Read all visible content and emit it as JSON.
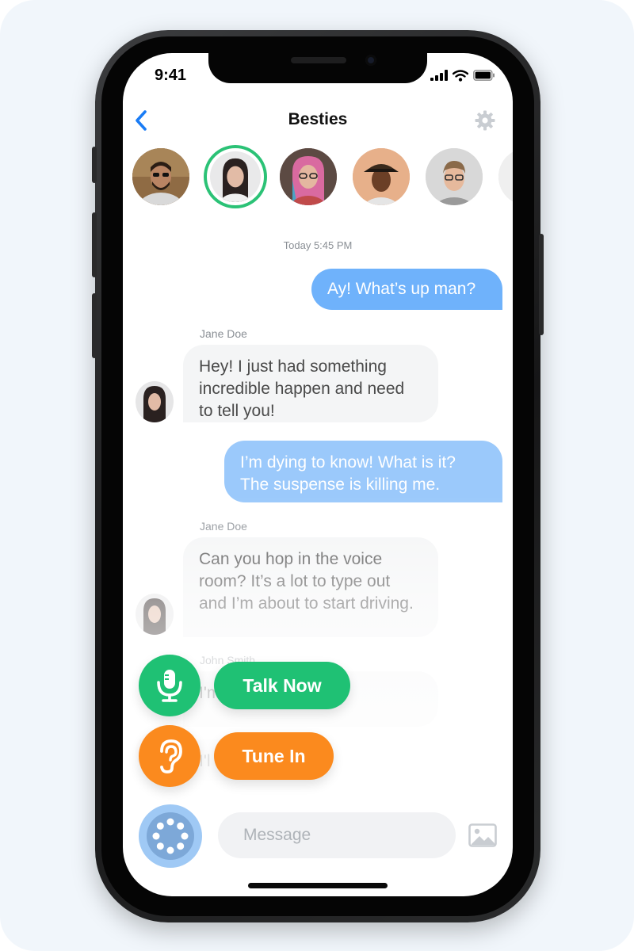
{
  "status_bar": {
    "time": "9:41"
  },
  "header": {
    "title": "Besties",
    "back_icon": "chevron-left-icon",
    "settings_icon": "gear-icon"
  },
  "avatars": [
    {
      "name": "member-1",
      "active": false
    },
    {
      "name": "member-2",
      "active": true
    },
    {
      "name": "member-3",
      "active": false
    },
    {
      "name": "member-4",
      "active": false
    },
    {
      "name": "member-5",
      "active": false
    },
    {
      "name": "member-6",
      "active": false
    }
  ],
  "chat": {
    "timestamp": "Today 5:45 PM",
    "messages": [
      {
        "direction": "out",
        "text": "Ay! What’s up man?"
      },
      {
        "direction": "in",
        "sender": "Jane Doe",
        "text": "Hey! I just had something incredible happen and need to tell you!"
      },
      {
        "direction": "out",
        "text": "I’m dying to know! What is it? The suspense is killing me."
      },
      {
        "direction": "in",
        "sender": "Jane Doe",
        "text": "Can you hop in the voice room? It’s a lot to type out and I’m about to start driving."
      },
      {
        "direction": "in",
        "sender": "John Smith",
        "text": "I'm ... want to hear!"
      },
      {
        "direction": "in",
        "sender": "",
        "text": "I'l"
      }
    ]
  },
  "actions": {
    "talk_now": {
      "label": "Talk Now",
      "icon": "microphone-icon",
      "color": "#1fc174"
    },
    "tune_in": {
      "label": "Tune In",
      "icon": "ear-icon",
      "color": "#fb8a1e"
    }
  },
  "composer": {
    "placeholder": "Message",
    "voice_icon": "voice-room-icon",
    "image_icon": "image-icon"
  },
  "colors": {
    "accent": "#1a7cf5",
    "outgoing_bubble": "#6fb2fb",
    "incoming_bubble": "#f4f5f6",
    "active_ring": "#2bc276"
  }
}
